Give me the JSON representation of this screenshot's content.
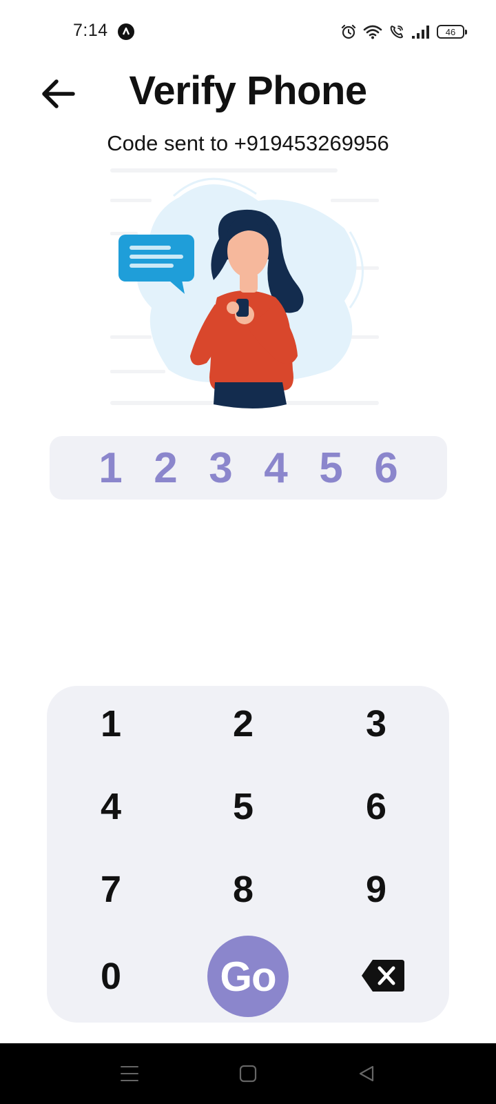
{
  "status_bar": {
    "time": "7:14",
    "battery_level": "46",
    "icons": [
      "app-notification-icon",
      "alarm-icon",
      "wifi-icon",
      "wifi-calling-icon",
      "signal-icon",
      "battery-icon"
    ]
  },
  "header": {
    "title": "Verify Phone",
    "back_icon": "arrow-left-icon"
  },
  "subtitle": "Code sent to +919453269956",
  "otp": {
    "digits": [
      "1",
      "2",
      "3",
      "4",
      "5",
      "6"
    ],
    "color": "#8b86cc"
  },
  "keypad": {
    "keys": [
      "1",
      "2",
      "3",
      "4",
      "5",
      "6",
      "7",
      "8",
      "9",
      "0"
    ],
    "go_label": "Go",
    "backspace_icon": "backspace-icon",
    "go_color": "#8b86cc",
    "background": "#f0f1f6"
  },
  "nav_bar": {
    "icons": [
      "menu-icon",
      "home-icon",
      "back-triangle-icon"
    ]
  }
}
